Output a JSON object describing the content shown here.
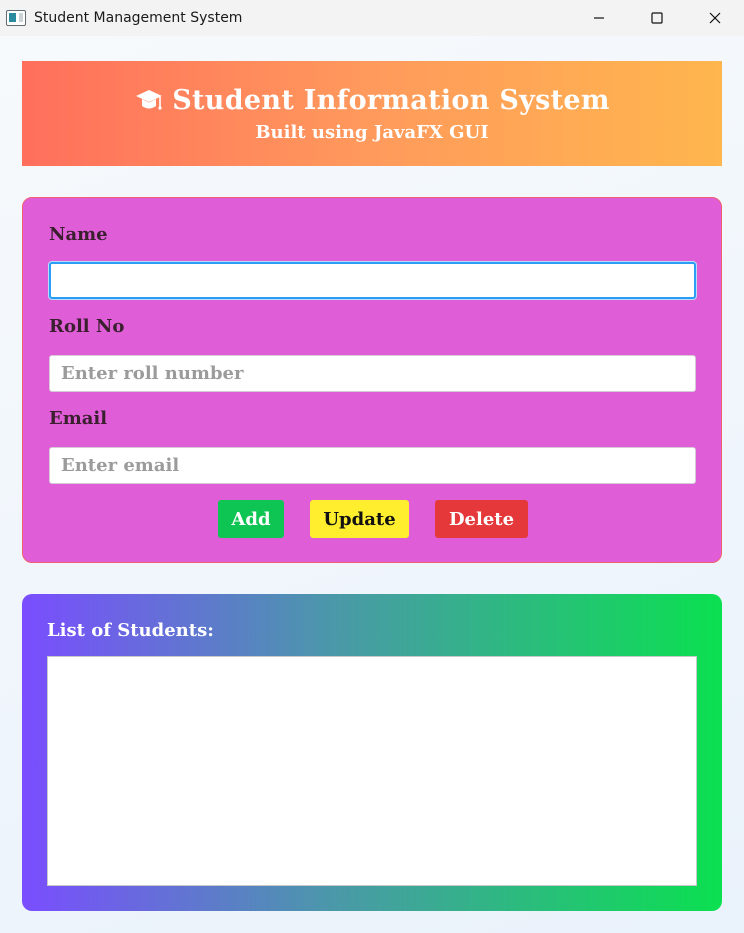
{
  "window": {
    "title": "Student Management System"
  },
  "header": {
    "icon": "graduation-cap-icon",
    "title": "Student Information System",
    "subtitle": "Built using JavaFX GUI"
  },
  "form": {
    "name_label": "Name",
    "name_value": "",
    "name_placeholder": "",
    "roll_label": "Roll No",
    "roll_value": "",
    "roll_placeholder": "Enter roll number",
    "email_label": "Email",
    "email_value": "",
    "email_placeholder": "Enter email"
  },
  "buttons": {
    "add": "Add",
    "update": "Update",
    "delete": "Delete"
  },
  "list": {
    "label": "List of Students:",
    "items": []
  },
  "colors": {
    "header_gradient": [
      "#ff6f5c",
      "#ffb64e"
    ],
    "form_card": "#df5ed8",
    "add": "#0ec453",
    "update": "#ffee2e",
    "delete": "#e5383b",
    "list_gradient": [
      "#7a4dff",
      "#0be050"
    ]
  }
}
